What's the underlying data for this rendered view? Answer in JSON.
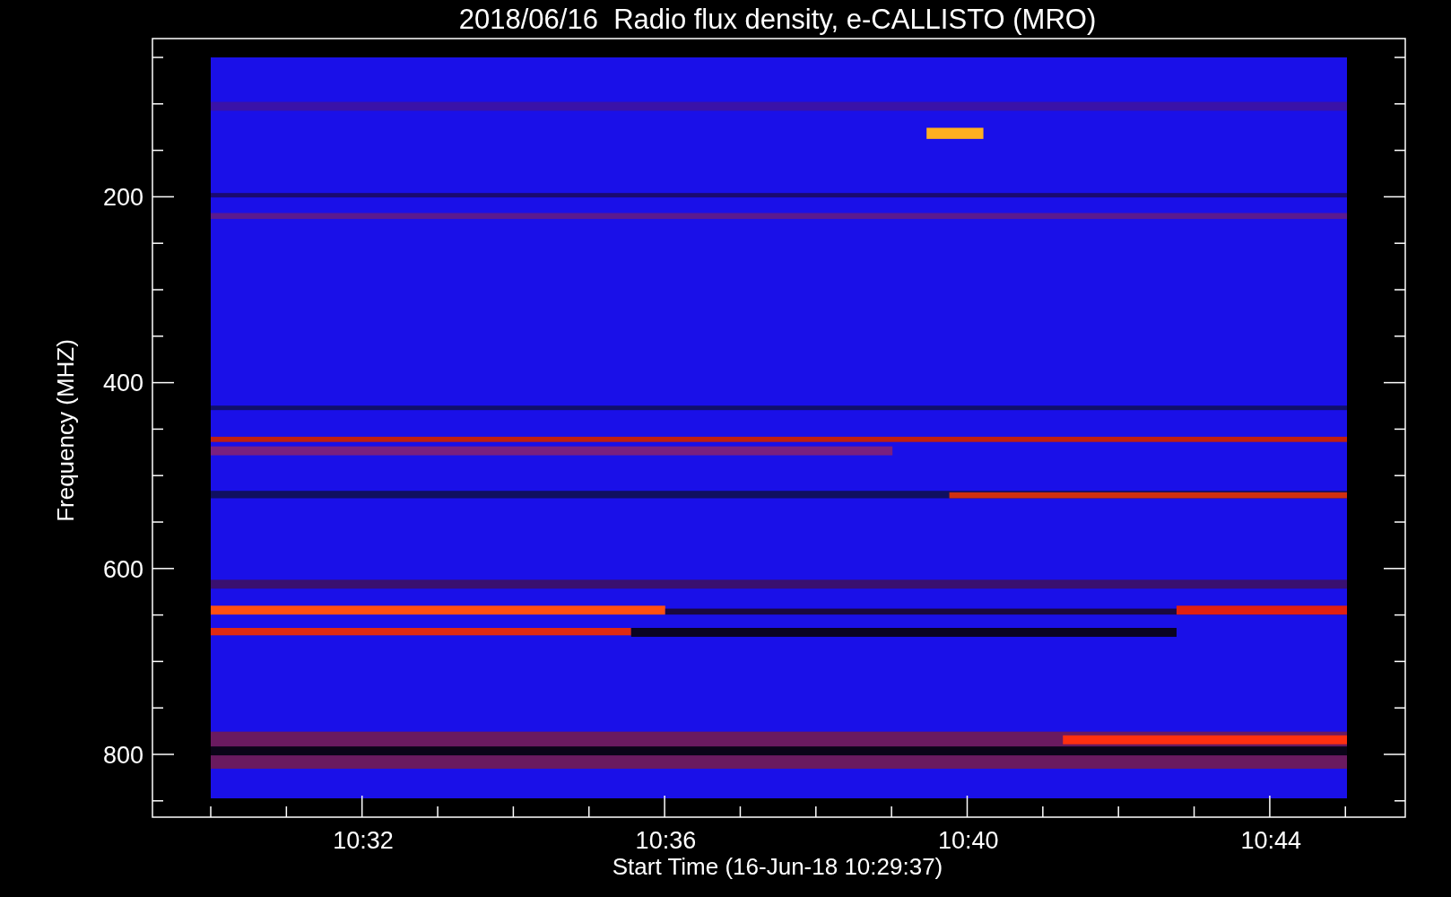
{
  "title": "2018/06/16  Radio flux density, e-CALLISTO (MRO)",
  "y_axis": {
    "label": "Frequency (MHZ)",
    "ticks": [
      "200",
      "400",
      "600",
      "800"
    ]
  },
  "x_axis": {
    "label": "Start Time (16-Jun-18 10:29:37)",
    "ticks": [
      "10:32",
      "10:36",
      "10:40",
      "10:44"
    ]
  }
}
